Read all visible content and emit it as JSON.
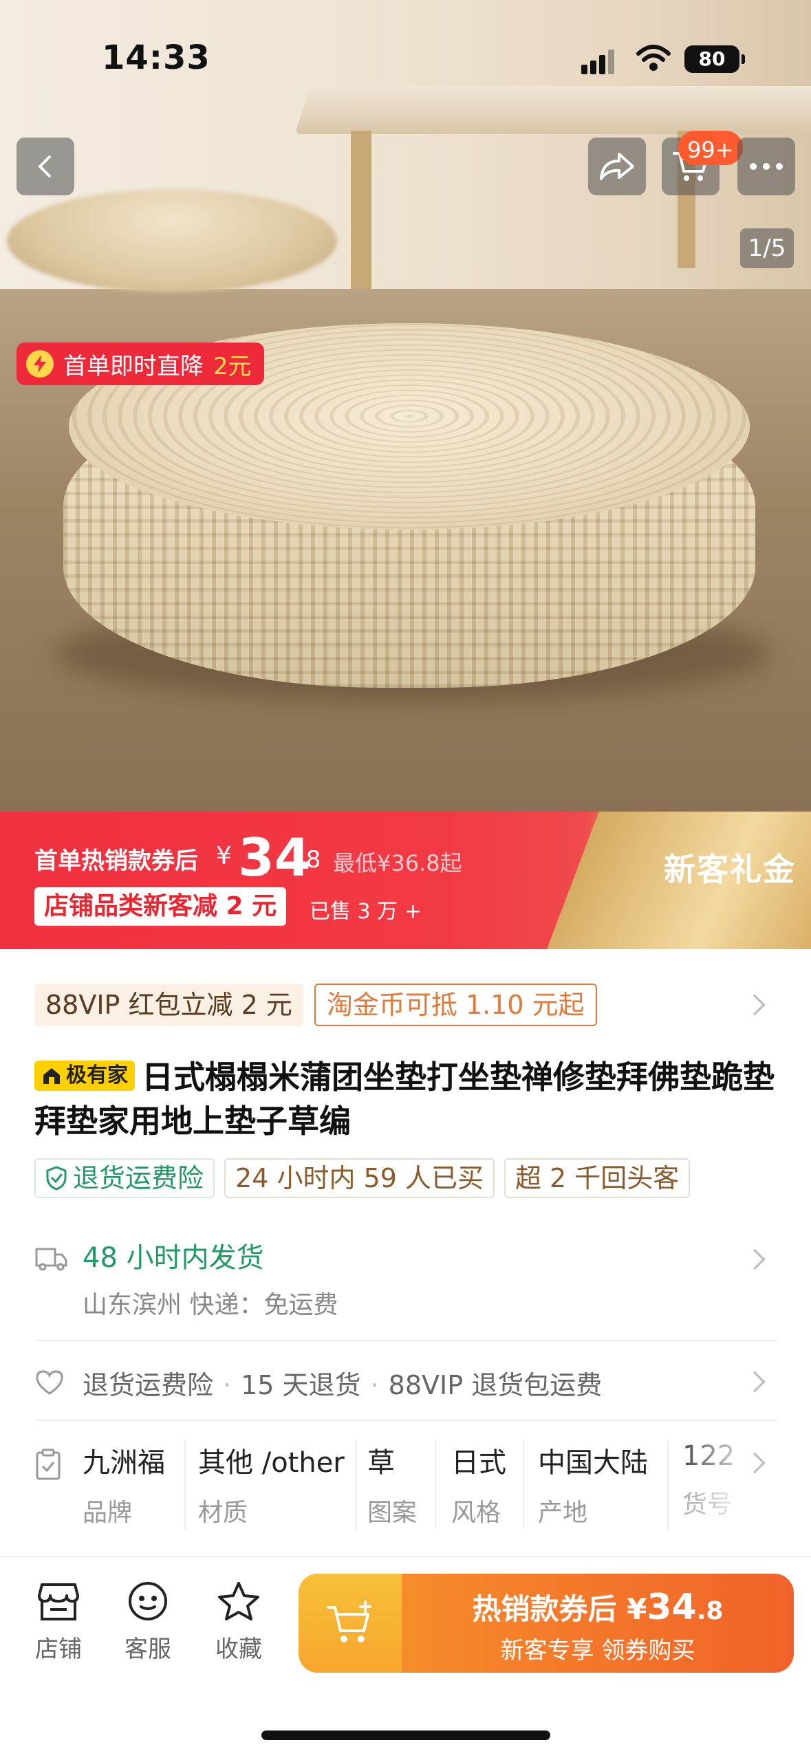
{
  "status_bar": {
    "time": "14:33",
    "battery": "80"
  },
  "hero": {
    "cart_badge": "99+",
    "page_indicator": "1/5",
    "first_order_label": "首单即时直降",
    "first_order_amount": "2元"
  },
  "price_banner": {
    "label": "首单热销款券后",
    "currency": "¥",
    "price_int": "34",
    "price_dec": ".8",
    "lowest": "最低¥36.8起",
    "coupon_tag": "店铺品类新客减 2 元",
    "sold": "已售 3 万 +",
    "gift": "新客礼金"
  },
  "promos": {
    "vip": "88VIP 红包立减 2 元",
    "coin": "淘金币可抵 1.10 元起"
  },
  "product": {
    "brand_tag": "极有家",
    "title": "日式榻榻米蒲团坐垫打坐垫禅修垫拜佛垫跪垫拜垫家用地上垫子草编"
  },
  "services": [
    {
      "label": "退货运费险"
    },
    {
      "label": "24 小时内 59 人已买"
    },
    {
      "label": "超 2 千回头客"
    }
  ],
  "shipping": {
    "main": "48 小时内发货",
    "sub": "山东滨州  快递：免运费"
  },
  "returns": {
    "a": "退货运费险",
    "b": "15 天退货",
    "c": "88VIP 退货包运费"
  },
  "params": [
    {
      "value": "九洲福",
      "key": "品牌"
    },
    {
      "value": "其他 /other",
      "key": "材质"
    },
    {
      "value": "草",
      "key": "图案"
    },
    {
      "value": "日式",
      "key": "风格"
    },
    {
      "value": "中国大陆",
      "key": "产地"
    },
    {
      "value": "122",
      "key": "货号"
    }
  ],
  "bottom_nav": {
    "shop": "店铺",
    "service": "客服",
    "favorite": "收藏",
    "buy_line1_prefix": "热销款券后",
    "buy_currency": "¥",
    "buy_price_int": "34",
    "buy_price_dec": ".8",
    "buy_line2": "新客专享  领券购买"
  }
}
